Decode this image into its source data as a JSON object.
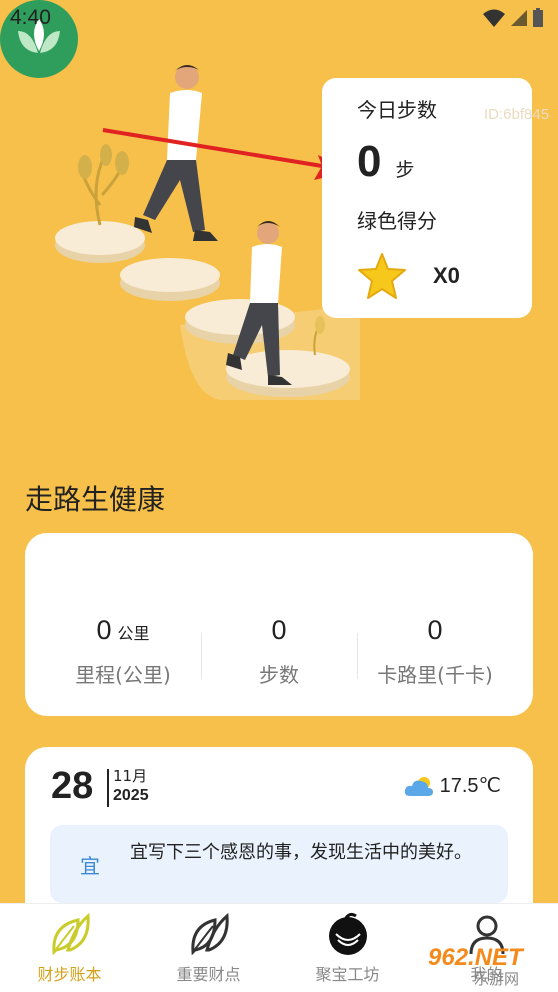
{
  "status_bar": {
    "time": "4:40"
  },
  "step_card": {
    "title": "今日步数",
    "steps": "0",
    "steps_unit": "步",
    "green_score_title": "绿色得分",
    "score": "X0"
  },
  "device_id": "ID:6bf845",
  "health": {
    "section_title": "走路生健康",
    "metrics": [
      {
        "value": "0",
        "sub": "公里",
        "label": "里程(公里)"
      },
      {
        "value": "0",
        "sub": "",
        "label": "步数"
      },
      {
        "value": "0",
        "sub": "",
        "label": "卡路里(千卡)"
      }
    ]
  },
  "calendar": {
    "day": "28",
    "month": "11月",
    "year": "2025",
    "temperature": "17.5℃",
    "advice_tag": "宜",
    "advice_text": "宜写下三个感恩的事，发现生活中的美好。"
  },
  "tabbar": {
    "tabs": [
      {
        "label": "财步账本",
        "icon": "leaf-icon"
      },
      {
        "label": "重要财点",
        "icon": "leaf-outline-icon"
      },
      {
        "label": "聚宝工坊",
        "icon": "workshop-icon"
      },
      {
        "label": "我的",
        "icon": "user-icon"
      }
    ]
  },
  "watermark": {
    "brand": "962.NET",
    "site": "乐游网"
  },
  "colors": {
    "background": "#f7c04a",
    "accent": "#d4a21a",
    "advice_bg": "#eaf3fd",
    "logo_green": "#2f9e5d"
  }
}
